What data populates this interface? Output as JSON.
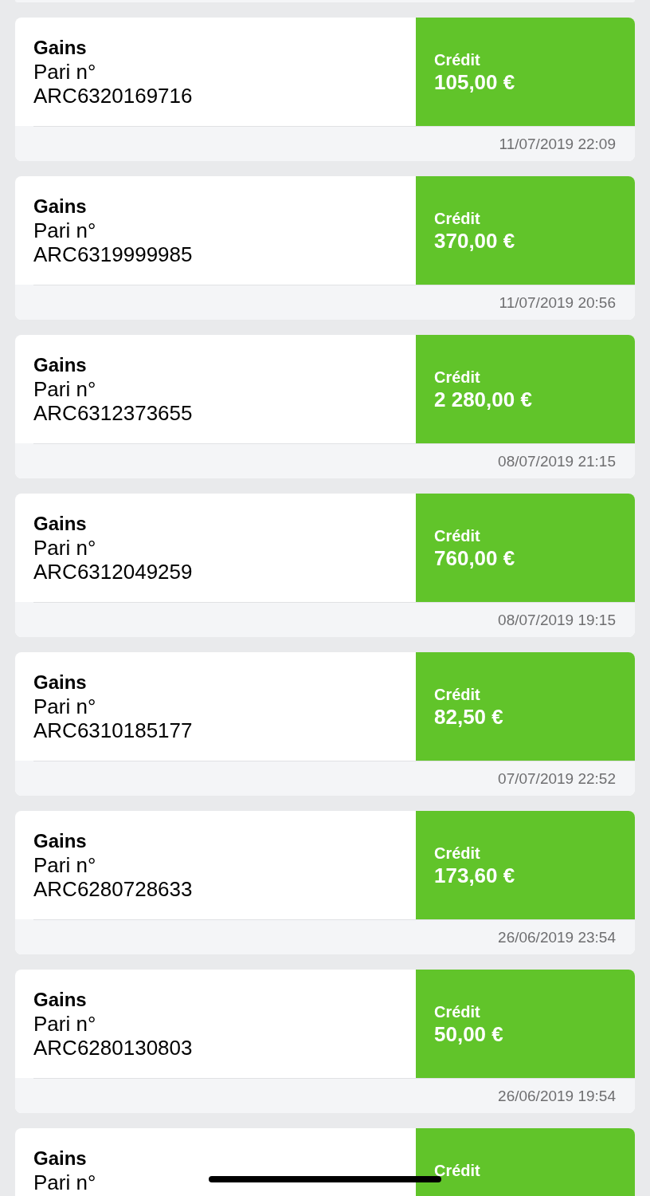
{
  "transactions": [
    {
      "title": "Gains",
      "label": "Pari n°",
      "reference": "ARC6320169716",
      "type_label": "Crédit",
      "amount": "105,00 €",
      "date": "11/07/2019 22:09"
    },
    {
      "title": "Gains",
      "label": "Pari n°",
      "reference": "ARC6319999985",
      "type_label": "Crédit",
      "amount": "370,00 €",
      "date": "11/07/2019 20:56"
    },
    {
      "title": "Gains",
      "label": "Pari n°",
      "reference": "ARC6312373655",
      "type_label": "Crédit",
      "amount": "2 280,00 €",
      "date": "08/07/2019 21:15"
    },
    {
      "title": "Gains",
      "label": "Pari n°",
      "reference": "ARC6312049259",
      "type_label": "Crédit",
      "amount": "760,00 €",
      "date": "08/07/2019 19:15"
    },
    {
      "title": "Gains",
      "label": "Pari n°",
      "reference": "ARC6310185177",
      "type_label": "Crédit",
      "amount": "82,50 €",
      "date": "07/07/2019 22:52"
    },
    {
      "title": "Gains",
      "label": "Pari n°",
      "reference": "ARC6280728633",
      "type_label": "Crédit",
      "amount": "173,60 €",
      "date": "26/06/2019 23:54"
    },
    {
      "title": "Gains",
      "label": "Pari n°",
      "reference": "ARC6280130803",
      "type_label": "Crédit",
      "amount": "50,00 €",
      "date": "26/06/2019 19:54"
    },
    {
      "title": "Gains",
      "label": "Pari n°",
      "type_label": "Crédit"
    }
  ]
}
